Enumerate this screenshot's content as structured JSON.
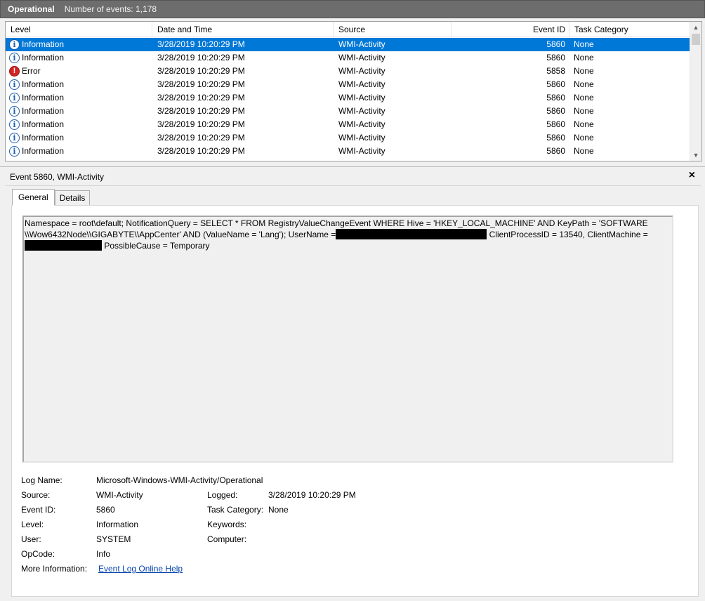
{
  "header": {
    "title": "Operational",
    "count_text": "Number of events: 1,178"
  },
  "columns": {
    "level": "Level",
    "date": "Date and Time",
    "source": "Source",
    "event_id": "Event ID",
    "task": "Task Category"
  },
  "rows": [
    {
      "level": "Information",
      "icon": "info-icon",
      "date": "3/28/2019 10:20:29 PM",
      "source": "WMI-Activity",
      "event_id": "5860",
      "task": "None"
    },
    {
      "level": "Information",
      "icon": "info-icon",
      "date": "3/28/2019 10:20:29 PM",
      "source": "WMI-Activity",
      "event_id": "5860",
      "task": "None"
    },
    {
      "level": "Error",
      "icon": "error-icon",
      "date": "3/28/2019 10:20:29 PM",
      "source": "WMI-Activity",
      "event_id": "5858",
      "task": "None"
    },
    {
      "level": "Information",
      "icon": "info-icon",
      "date": "3/28/2019 10:20:29 PM",
      "source": "WMI-Activity",
      "event_id": "5860",
      "task": "None"
    },
    {
      "level": "Information",
      "icon": "info-icon",
      "date": "3/28/2019 10:20:29 PM",
      "source": "WMI-Activity",
      "event_id": "5860",
      "task": "None"
    },
    {
      "level": "Information",
      "icon": "info-icon",
      "date": "3/28/2019 10:20:29 PM",
      "source": "WMI-Activity",
      "event_id": "5860",
      "task": "None"
    },
    {
      "level": "Information",
      "icon": "info-icon",
      "date": "3/28/2019 10:20:29 PM",
      "source": "WMI-Activity",
      "event_id": "5860",
      "task": "None"
    },
    {
      "level": "Information",
      "icon": "info-icon",
      "date": "3/28/2019 10:20:29 PM",
      "source": "WMI-Activity",
      "event_id": "5860",
      "task": "None"
    },
    {
      "level": "Information",
      "icon": "info-icon",
      "date": "3/28/2019 10:20:29 PM",
      "source": "WMI-Activity",
      "event_id": "5860",
      "task": "None"
    }
  ],
  "detail": {
    "title": "Event 5860, WMI-Activity",
    "close": "×",
    "tabs": {
      "general": "General",
      "details": "Details"
    },
    "description": {
      "line1": "Namespace = root\\default; NotificationQuery = SELECT * FROM RegistryValueChangeEvent WHERE Hive = 'HKEY_LOCAL_MACHINE' AND KeyPath = 'SOFTWARE",
      "line2a": "\\\\Wow6432Node\\\\GIGABYTE\\\\AppCenter' AND (ValueName = 'Lang'); UserName =",
      "line2b": " ClientProcessID = 13540, ClientMachine =",
      "line3": " PossibleCause = Temporary"
    },
    "properties": {
      "log_name_label": "Log Name:",
      "log_name": "Microsoft-Windows-WMI-Activity/Operational",
      "source_label": "Source:",
      "source": "WMI-Activity",
      "logged_label": "Logged:",
      "logged": "3/28/2019 10:20:29 PM",
      "event_id_label": "Event ID:",
      "event_id": "5860",
      "task_label": "Task Category:",
      "task": "None",
      "level_label": "Level:",
      "level": "Information",
      "keywords_label": "Keywords:",
      "user_label": "User:",
      "user": "SYSTEM",
      "computer_label": "Computer:",
      "opcode_label": "OpCode:",
      "opcode": "Info",
      "more_info_label": "More Information:",
      "more_info_link": "Event Log Online Help"
    }
  },
  "colors": {
    "selection": "#0078d7",
    "header_bar": "#6d6d6d",
    "link": "#0645ad",
    "error": "#d32424",
    "info": "#1c5fb0"
  }
}
